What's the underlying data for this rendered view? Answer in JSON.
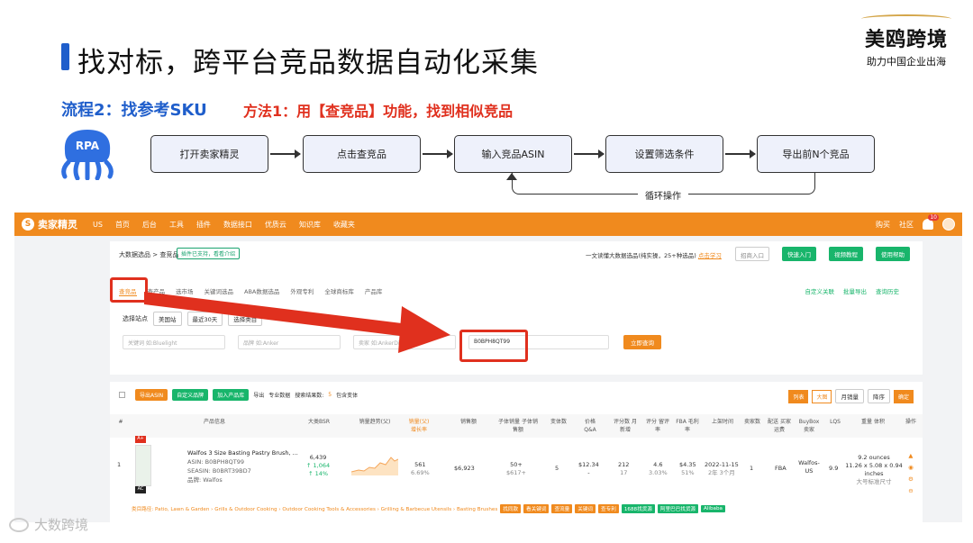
{
  "slide": {
    "title": "找对标，跨平台竞品数据自动化采集",
    "flow_label": "流程2：找参考SKU",
    "method_label": "方法1：用【查竞品】功能，找到相似竞品",
    "brand": {
      "name": "美鸥跨境",
      "sub": "助力中国企业出海"
    },
    "rpa_label": "RPA",
    "steps": [
      "打开卖家精灵",
      "点击查竞品",
      "输入竞品ASIN",
      "设置筛选条件",
      "导出前N个竞品"
    ],
    "loop_label": "循环操作",
    "watermark": "大数跨境"
  },
  "app": {
    "logo": "卖家精灵",
    "region": "US",
    "nav": [
      "首页",
      "后台",
      "工具",
      "插件",
      "数据接口",
      "优质云",
      "知识库",
      "收藏夹"
    ],
    "nav_right": [
      "购买",
      "社区"
    ],
    "notif_count": "10",
    "breadcrumb": "大数据选品 > 查竞品",
    "plugin_tag": "插件已支持，看看介绍",
    "notice_text": "一文读懂大数据选品(纯实操，25+种选品)",
    "notice_link": "点击学习",
    "btn_collect": "招商入口",
    "btn_quick": "快速入门",
    "btn_video": "视频教程",
    "btn_help": "使用帮助",
    "tabs": [
      "查竞品",
      "查产品",
      "选市场",
      "关键词选品",
      "ABA数据选品",
      "外观专利",
      "全球商标库",
      "产品库"
    ],
    "tab_links": [
      "自定义关联",
      "批量导出",
      "查询历史"
    ],
    "site_label": "选择站点",
    "site_value": "美国站",
    "period_value": "最近30天",
    "category_placeholder": "选择类目",
    "input_keyword": "关键词 如:Bluelight",
    "input_brand": "品牌 如:Anker",
    "input_seller": "卖家 如:AnkerDirect",
    "input_asin": "B0BPH8QT99",
    "search_button": "立即查询"
  },
  "results": {
    "toolbar": [
      "导出ASIN",
      "自定义品牌",
      "加入产品库",
      "导出",
      "专业数据"
    ],
    "count_label": "搜索结果数:",
    "count": "5",
    "include_variant": "包含变体",
    "view_list": "列表",
    "view_grid": "大图",
    "sort_label": "月销量",
    "order_label": "降序",
    "confirm": "确定",
    "columns": [
      "#",
      "产品信息",
      "大类BSR",
      "销量趋势(父)",
      "销量(父) 增长率",
      "销售额",
      "子体销量 子体销售额",
      "变体数",
      "价格 Q&A",
      "评分数 月新增",
      "评分 留评率",
      "FBA 毛利率",
      "上架时间",
      "卖家数",
      "配送 买家运费",
      "BuyBox 卖家",
      "LQS",
      "重量 体积",
      "操作"
    ],
    "rows": [
      {
        "index": "1",
        "title": "Walfos 3 Size Basting Pastry Brush, ...",
        "asin": "ASIN: B0BPH8QT99",
        "sub_asin": "SEASIN: B0BRT39BD7",
        "brand": "品牌: Walfos",
        "badge_top": "A+",
        "badge_bottom": "AC",
        "bsr": "6,439",
        "bsr_change": "↑ 1,064",
        "bsr_pct": "↑ 14%",
        "sales": "561",
        "sales_growth": "6.69%",
        "revenue": "$6,923",
        "child_sales": "50+",
        "child_revenue": "$617+",
        "variants": "5",
        "price": "$12.34",
        "qa": "-",
        "ratings": "212",
        "ratings_new": "17",
        "rating": "4.6",
        "review_rate": "3.03%",
        "fba": "$4.35",
        "margin": "51%",
        "launch": "2022-11-15",
        "launch_age": "2年 3个月",
        "sellers": "1",
        "fulfillment": "FBA",
        "buybox": "Walfos-US",
        "lqs": "9.9",
        "weight": "9.2 ounces",
        "size": "11.26 x 5.08 x 0.94 inches",
        "size_type": "大号标准尺寸"
      }
    ],
    "categories": "类目路径: Patio, Lawn & Garden › Grills & Outdoor Cooking › Outdoor Cooking Tools & Accessories › Grilling & Barbecue Utensils › Basting Brushes",
    "cat_tags": [
      "找同款",
      "看关键词",
      "查流量",
      "关键词",
      "查专利",
      "1688找货源",
      "阿里巴巴找货源",
      "Alibaba"
    ]
  },
  "colors": {
    "accent_orange": "#f08a1e",
    "accent_green": "#18b56b",
    "highlight_red": "#e0301e",
    "title_blue": "#1f5ecb"
  }
}
